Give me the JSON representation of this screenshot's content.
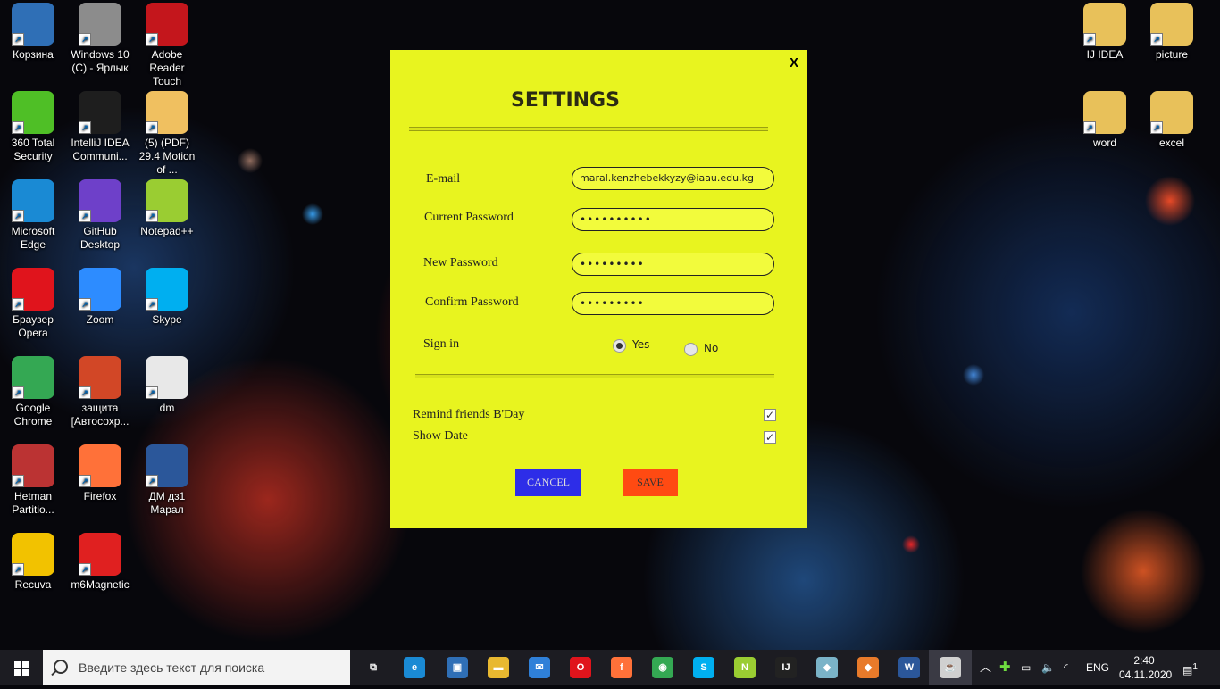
{
  "desktop_icons": [
    {
      "label": "Корзина",
      "icon": "recycle-bin-icon",
      "color": "#2f6fb6"
    },
    {
      "label": "Windows 10 (C) - Ярлык",
      "icon": "drive-icon",
      "color": "#8c8c8c"
    },
    {
      "label": "Adobe Reader Touch",
      "icon": "pdf-reader-icon",
      "color": "#c4161c"
    },
    {
      "label": "360 Total Security",
      "icon": "plus-shield-icon",
      "color": "#4fbf26"
    },
    {
      "label": "IntelliJ IDEA Communi...",
      "icon": "intellij-icon",
      "color": "#1e1e1e"
    },
    {
      "label": "(5) (PDF) 29.4 Motion of ...",
      "icon": "chrome-doc-icon",
      "color": "#f0c060"
    },
    {
      "label": "Microsoft Edge",
      "icon": "edge-icon",
      "color": "#1a8ad4"
    },
    {
      "label": "GitHub Desktop",
      "icon": "github-icon",
      "color": "#6e40c9"
    },
    {
      "label": "Notepad++",
      "icon": "notepad-icon",
      "color": "#9acd32"
    },
    {
      "label": "Браузер Opera",
      "icon": "opera-icon",
      "color": "#e0141c"
    },
    {
      "label": "Zoom",
      "icon": "zoom-icon",
      "color": "#2d8cff"
    },
    {
      "label": "Skype",
      "icon": "skype-icon",
      "color": "#00aff0"
    },
    {
      "label": "Google Chrome",
      "icon": "chrome-icon",
      "color": "#34a853"
    },
    {
      "label": "защита [Автосохр...",
      "icon": "powerpoint-icon",
      "color": "#d24726"
    },
    {
      "label": "dm",
      "icon": "text-file-icon",
      "color": "#e8e8e8"
    },
    {
      "label": "Hetman Partitio...",
      "icon": "partition-icon",
      "color": "#b33"
    },
    {
      "label": "Firefox",
      "icon": "firefox-icon",
      "color": "#ff7139"
    },
    {
      "label": "ДМ дз1 Марал",
      "icon": "word-doc-icon",
      "color": "#2b579a"
    },
    {
      "label": "Recuva",
      "icon": "recuva-icon",
      "color": "#f2c200"
    },
    {
      "label": "m6Magnetic",
      "icon": "pdf-file-icon",
      "color": "#e02020"
    }
  ],
  "right_icons": [
    {
      "label": "IJ IDEA",
      "icon": "folder-icon",
      "color": "#e8c15a"
    },
    {
      "label": "picture",
      "icon": "folder-icon",
      "color": "#e8c15a"
    },
    {
      "label": "word",
      "icon": "folder-icon",
      "color": "#e8c15a"
    },
    {
      "label": "excel",
      "icon": "folder-icon",
      "color": "#e8c15a"
    }
  ],
  "dialog": {
    "close": "X",
    "title": "SETTINGS",
    "email_label": "E-mail",
    "email_value": "maral.kenzhebekkyzy@iaau.edu.kg",
    "current_password_label": "Current Password",
    "current_password_value": "••••••••••",
    "new_password_label": "New Password",
    "new_password_value": "•••••••••",
    "confirm_password_label": "Confirm Password",
    "confirm_password_value": "•••••••••",
    "sign_in_label": "Sign in",
    "sign_in_yes": "Yes",
    "sign_in_no": "No",
    "sign_in_selected": "Yes",
    "remind_label": "Remind friends B'Day",
    "remind_checked": true,
    "show_date_label": "Show Date",
    "show_date_checked": true,
    "cancel": "CANCEL",
    "save": "SAVE",
    "colors": {
      "background": "#e8f41f",
      "cancel": "#2d2de8",
      "save": "#ff4a12"
    }
  },
  "taskbar": {
    "search_placeholder": "Введите здесь текст для поиска",
    "apps": [
      {
        "name": "task-view",
        "glyph": "⧉",
        "color": "transparent"
      },
      {
        "name": "edge",
        "glyph": "e",
        "color": "#1a8ad4"
      },
      {
        "name": "store",
        "glyph": "▣",
        "color": "#2f6fb6"
      },
      {
        "name": "explorer",
        "glyph": "▬",
        "color": "#e8b830"
      },
      {
        "name": "mail",
        "glyph": "✉",
        "color": "#2f80d8"
      },
      {
        "name": "opera",
        "glyph": "O",
        "color": "#e0141c"
      },
      {
        "name": "firefox",
        "glyph": "f",
        "color": "#ff7139"
      },
      {
        "name": "chrome",
        "glyph": "◉",
        "color": "#34a853"
      },
      {
        "name": "skype",
        "glyph": "S",
        "color": "#00aff0"
      },
      {
        "name": "notepad",
        "glyph": "N",
        "color": "#9acd32"
      },
      {
        "name": "intellij",
        "glyph": "IJ",
        "color": "#222"
      },
      {
        "name": "app-blue",
        "glyph": "◆",
        "color": "#7ab3c8"
      },
      {
        "name": "app-orange",
        "glyph": "◆",
        "color": "#e87a2a"
      },
      {
        "name": "word",
        "glyph": "W",
        "color": "#2b579a"
      },
      {
        "name": "java",
        "glyph": "☕",
        "color": "#d0d0d0"
      }
    ],
    "language": "ENG",
    "time": "2:40",
    "date": "04.11.2020",
    "notifications": "1"
  }
}
